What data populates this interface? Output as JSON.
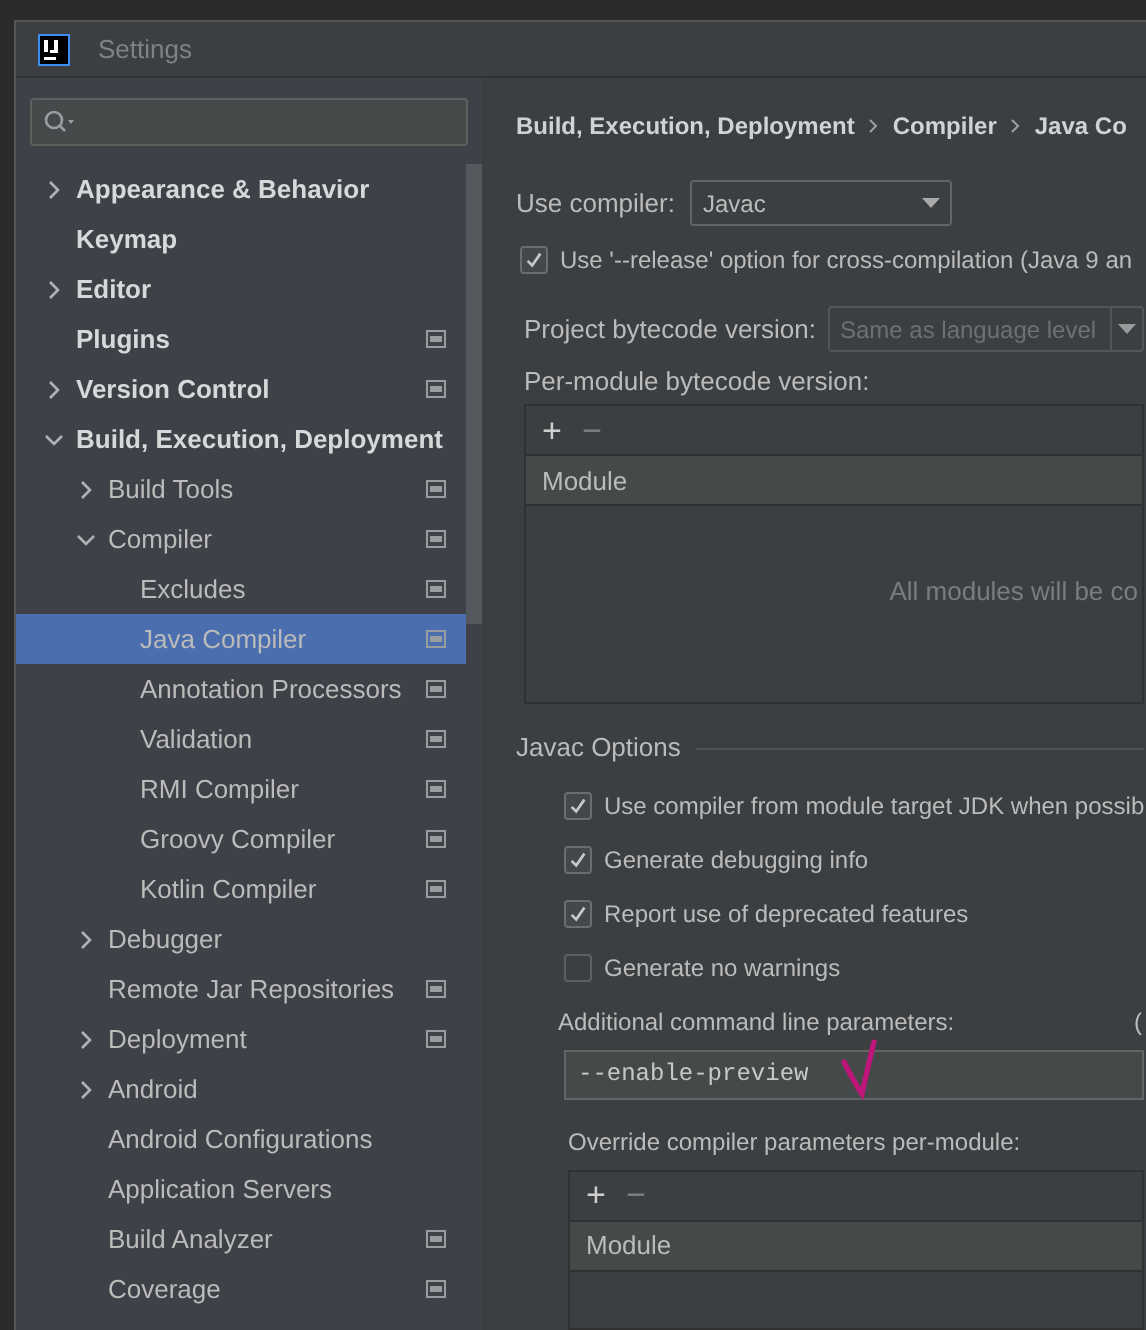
{
  "window": {
    "title": "Settings"
  },
  "tree": [
    {
      "label": "Appearance & Behavior",
      "expanded": false,
      "project_level": false,
      "selected": false
    },
    {
      "label": "Keymap",
      "project_level": false,
      "selected": false
    },
    {
      "label": "Editor",
      "expanded": false,
      "project_level": false,
      "selected": false
    },
    {
      "label": "Plugins",
      "project_level": true,
      "selected": false
    },
    {
      "label": "Version Control",
      "expanded": false,
      "project_level": true,
      "selected": false
    },
    {
      "label": "Build, Execution, Deployment",
      "expanded": true,
      "project_level": false,
      "selected": false,
      "children": [
        {
          "label": "Build Tools",
          "expanded": false,
          "project_level": true,
          "selected": false
        },
        {
          "label": "Compiler",
          "expanded": true,
          "project_level": true,
          "selected": false,
          "children": [
            {
              "label": "Excludes",
              "project_level": true,
              "selected": false
            },
            {
              "label": "Java Compiler",
              "project_level": true,
              "selected": true
            },
            {
              "label": "Annotation Processors",
              "project_level": true,
              "selected": false
            },
            {
              "label": "Validation",
              "project_level": true,
              "selected": false
            },
            {
              "label": "RMI Compiler",
              "project_level": true,
              "selected": false
            },
            {
              "label": "Groovy Compiler",
              "project_level": true,
              "selected": false
            },
            {
              "label": "Kotlin Compiler",
              "project_level": true,
              "selected": false
            }
          ]
        },
        {
          "label": "Debugger",
          "expanded": false,
          "project_level": false,
          "selected": false
        },
        {
          "label": "Remote Jar Repositories",
          "project_level": true,
          "selected": false
        },
        {
          "label": "Deployment",
          "expanded": false,
          "project_level": true,
          "selected": false
        },
        {
          "label": "Android",
          "expanded": false,
          "project_level": false,
          "selected": false
        },
        {
          "label": "Android Configurations",
          "project_level": false,
          "selected": false
        },
        {
          "label": "Application Servers",
          "project_level": false,
          "selected": false
        },
        {
          "label": "Build Analyzer",
          "project_level": true,
          "selected": false
        },
        {
          "label": "Coverage",
          "project_level": true,
          "selected": false
        }
      ]
    }
  ],
  "breadcrumb": [
    "Build, Execution, Deployment",
    "Compiler",
    "Java Co"
  ],
  "use_compiler": {
    "label": "Use compiler:",
    "value": "Javac"
  },
  "release_option": {
    "label": "Use '--release' option for cross-compilation (Java 9 an",
    "checked": true
  },
  "project_bytecode": {
    "label": "Project bytecode version:",
    "placeholder": "Same as language level",
    "disabled": true
  },
  "per_module_bytecode": {
    "label": "Per-module bytecode version:",
    "add": "+",
    "remove": "−",
    "column": "Module",
    "empty_text": "All modules will be co"
  },
  "javac_options": {
    "title": "Javac Options",
    "checkboxes": [
      {
        "label": "Use compiler from module target JDK when possib",
        "checked": true
      },
      {
        "label": "Generate debugging info",
        "checked": true
      },
      {
        "label": "Report use of deprecated features",
        "checked": true
      },
      {
        "label": "Generate no warnings",
        "checked": false
      }
    ],
    "additional_params": {
      "label": "Additional command line parameters:",
      "hint": "(",
      "value": "--enable-preview"
    },
    "override_params": {
      "label": "Override compiler parameters per-module:",
      "add": "+",
      "remove": "−",
      "column": "Module"
    }
  }
}
